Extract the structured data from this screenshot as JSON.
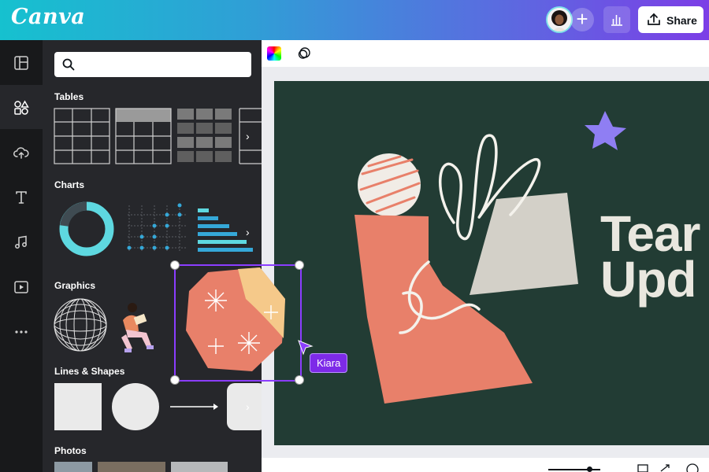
{
  "app": {
    "logo": "Canva"
  },
  "topbar": {
    "share_label": "Share",
    "add_icon": "plus-icon",
    "insights_icon": "bar-chart-icon",
    "share_icon": "upload-icon"
  },
  "rail": {
    "items": [
      "templates-icon",
      "elements-icon",
      "uploads-icon",
      "text-icon",
      "audio-icon",
      "video-icon",
      "more-icon"
    ],
    "active": "elements-icon"
  },
  "panel": {
    "search": {
      "value": "",
      "placeholder": ""
    },
    "sections": {
      "tables": "Tables",
      "charts": "Charts",
      "graphics": "Graphics",
      "lines_shapes": "Lines & Shapes",
      "photos": "Photos"
    }
  },
  "canvas": {
    "title_line1": "Tear",
    "title_line2": "Upd",
    "collaborator": "Kiara"
  },
  "colors": {
    "accent": "#8b3dff",
    "slide_bg": "#223c34",
    "coral": "#e8806a",
    "panel": "#26272b",
    "rail": "#18191b"
  }
}
